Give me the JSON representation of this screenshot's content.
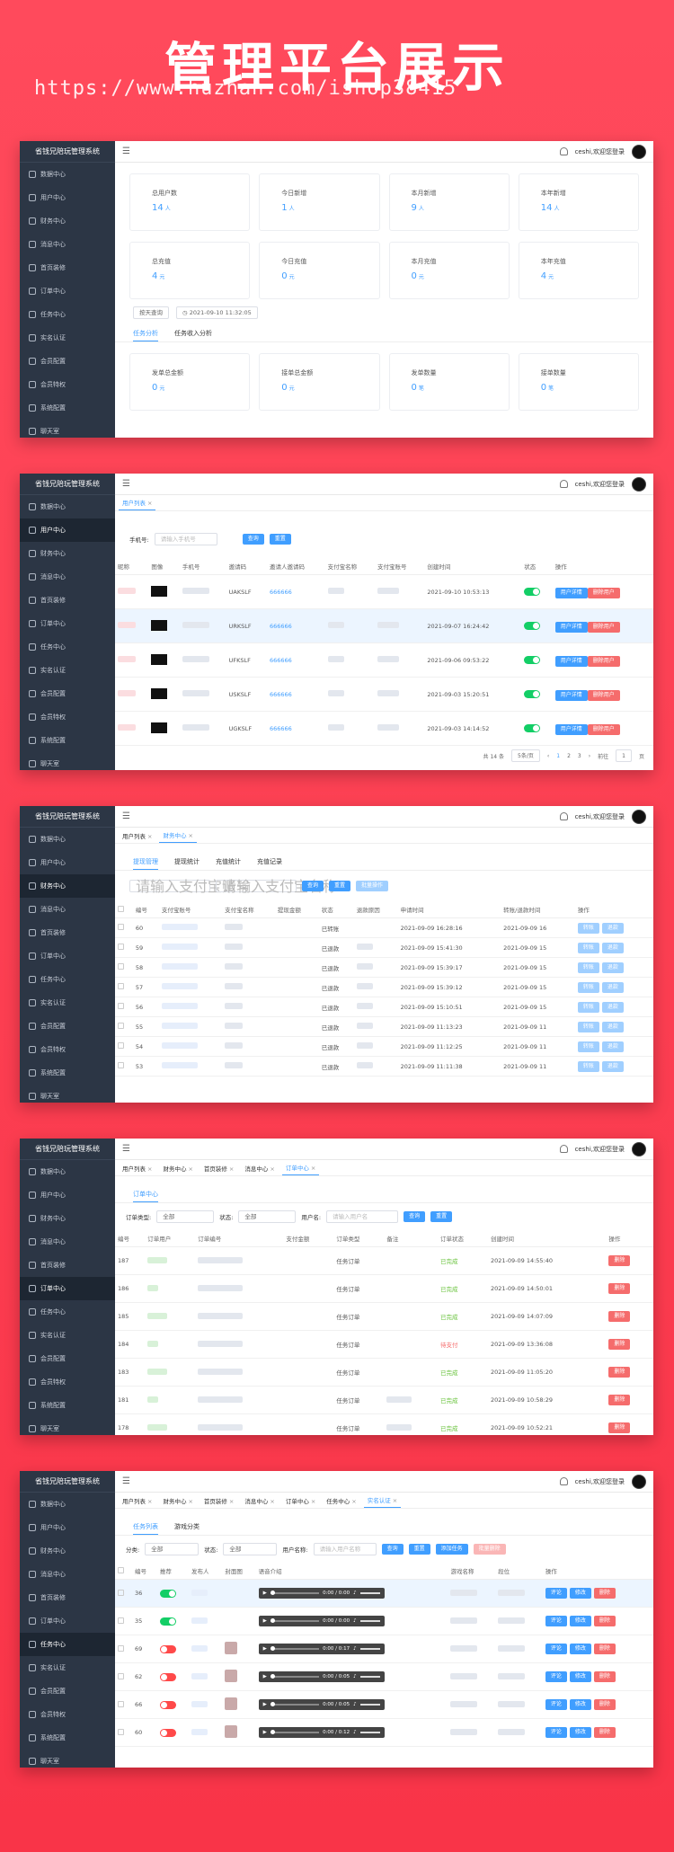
{
  "hero": {
    "title": "管理平台展示",
    "url": "https://www.huzhan.com/ishop38415"
  },
  "app": {
    "name": "省钱兄陪玩管理系统",
    "user": "ceshi",
    "greeting": ",欢迎您登录"
  },
  "sidebar": [
    "数据中心",
    "用户中心",
    "财务中心",
    "消息中心",
    "首页装修",
    "订单中心",
    "任务中心",
    "实名认证",
    "会员配置",
    "会员特权",
    "系统配置",
    "聊天室"
  ],
  "s1": {
    "cards_top": [
      {
        "label": "总用户数",
        "value": "14",
        "unit": "人"
      },
      {
        "label": "今日新增",
        "value": "1",
        "unit": "人"
      },
      {
        "label": "本月新增",
        "value": "9",
        "unit": "人"
      },
      {
        "label": "本年新增",
        "value": "14",
        "unit": "人"
      }
    ],
    "cards_mid": [
      {
        "label": "总充值",
        "value": "4",
        "unit": "元"
      },
      {
        "label": "今日充值",
        "value": "0",
        "unit": "元"
      },
      {
        "label": "本月充值",
        "value": "0",
        "unit": "元"
      },
      {
        "label": "本年充值",
        "value": "4",
        "unit": "元"
      }
    ],
    "filter_range": "按天查询",
    "filter_date": "2021-09-10 11:32:05",
    "subtabs": [
      "任务分析",
      "任务收入分析"
    ],
    "cards_bottom": [
      {
        "label": "发单总金额",
        "value": "0",
        "unit": "元"
      },
      {
        "label": "接单总金额",
        "value": "0",
        "unit": "元"
      },
      {
        "label": "发单数量",
        "value": "0",
        "unit": "笔"
      },
      {
        "label": "接单数量",
        "value": "0",
        "unit": "笔"
      }
    ]
  },
  "s2": {
    "tabs": [
      "用户列表"
    ],
    "phone_label": "手机号:",
    "phone_placeholder": "请输入手机号",
    "search": "查询",
    "reset": "重置",
    "headers": [
      "昵称",
      "图像",
      "手机号",
      "邀请码",
      "邀请人邀请码",
      "支付宝名称",
      "支付宝账号",
      "创建时间",
      "状态",
      "操作"
    ],
    "rows": [
      {
        "code": "UAKSLF",
        "inviter": "666666",
        "time": "2021-09-10 10:53:13"
      },
      {
        "code": "URKSLF",
        "inviter": "666666",
        "time": "2021-09-07 16:24:42"
      },
      {
        "code": "UFKSLF",
        "inviter": "666666",
        "time": "2021-09-06 09:53:22"
      },
      {
        "code": "USKSLF",
        "inviter": "666666",
        "time": "2021-09-03 15:20:51"
      },
      {
        "code": "UGKSLF",
        "inviter": "666666",
        "time": "2021-09-03 14:14:52"
      }
    ],
    "detail_btn": "用户详情",
    "del_btn": "删除用户",
    "total": "共 14 条",
    "page_size": "5条/页",
    "pages": [
      "1",
      "2",
      "3"
    ],
    "goto": "前往",
    "goto_page": "1",
    "page_unit": "页"
  },
  "s3": {
    "tabs": [
      "用户列表",
      "财务中心"
    ],
    "subtabs": [
      "提现管理",
      "提现统计",
      "充值统计",
      "充值记录"
    ],
    "ph_alipay": "请输入支付宝账号",
    "ph_name": "请输入支付宝名称",
    "search": "查询",
    "reset": "重置",
    "batch": "批量操作",
    "headers": [
      "编号",
      "支付宝账号",
      "支付宝名称",
      "提现金额",
      "状态",
      "退款原因",
      "申请时间",
      "转账/退款时间",
      "操作"
    ],
    "rows": [
      {
        "id": "60",
        "status": "已转账",
        "time": "2021-09-09 16:28:16",
        "time2": "2021-09-09 16"
      },
      {
        "id": "59",
        "status": "已退款",
        "time": "2021-09-09 15:41:30",
        "time2": "2021-09-09 15"
      },
      {
        "id": "58",
        "status": "已退款",
        "time": "2021-09-09 15:39:17",
        "time2": "2021-09-09 15"
      },
      {
        "id": "57",
        "status": "已退款",
        "time": "2021-09-09 15:39:12",
        "time2": "2021-09-09 15"
      },
      {
        "id": "56",
        "status": "已退款",
        "time": "2021-09-09 15:10:51",
        "time2": "2021-09-09 15"
      },
      {
        "id": "55",
        "status": "已退款",
        "time": "2021-09-09 11:13:23",
        "time2": "2021-09-09 11"
      },
      {
        "id": "54",
        "status": "已退款",
        "time": "2021-09-09 11:12:25",
        "time2": "2021-09-09 11"
      },
      {
        "id": "53",
        "status": "已退款",
        "time": "2021-09-09 11:11:38",
        "time2": "2021-09-09 11"
      }
    ],
    "btn_a": "转账",
    "btn_b": "退款"
  },
  "s4": {
    "tabs": [
      "用户列表",
      "财务中心",
      "首页装修",
      "消息中心",
      "订单中心"
    ],
    "subtabs": [
      "订单中心"
    ],
    "type_label": "订单类型:",
    "type_value": "全部",
    "status_label": "状态:",
    "status_value": "全部",
    "user_label": "用户名:",
    "user_placeholder": "请输入用户名",
    "search": "查询",
    "reset": "重置",
    "headers": [
      "编号",
      "订单用户",
      "订单编号",
      "支付金额",
      "订单类型",
      "备注",
      "订单状态",
      "创建时间",
      "操作"
    ],
    "rows": [
      {
        "id": "187",
        "type": "任务订单",
        "state": "已完成",
        "time": "2021-09-09 14:55:40"
      },
      {
        "id": "186",
        "type": "任务订单",
        "state": "已完成",
        "time": "2021-09-09 14:50:01"
      },
      {
        "id": "185",
        "type": "任务订单",
        "state": "已完成",
        "time": "2021-09-09 14:07:09"
      },
      {
        "id": "184",
        "type": "任务订单",
        "state": "待支付",
        "time": "2021-09-09 13:36:08"
      },
      {
        "id": "183",
        "type": "任务订单",
        "state": "已完成",
        "time": "2021-09-09 11:05:20"
      },
      {
        "id": "181",
        "type": "任务订单",
        "state": "已完成",
        "time": "2021-09-09 10:58:29"
      },
      {
        "id": "178",
        "type": "任务订单",
        "state": "已完成",
        "time": "2021-09-09 10:52:21"
      }
    ],
    "del_btn": "删除"
  },
  "s5": {
    "tabs": [
      "用户列表",
      "财务中心",
      "首页装修",
      "消息中心",
      "订单中心",
      "任务中心",
      "实名认证"
    ],
    "subtabs": [
      "任务列表",
      "游戏分类"
    ],
    "cat_label": "分类:",
    "cat_value": "全部",
    "status_label": "状态:",
    "status_value": "全部",
    "user_label": "用户名称:",
    "user_placeholder": "请输入用户名称",
    "search": "查询",
    "reset": "重置",
    "add": "添加任务",
    "batch": "批量删除",
    "headers": [
      "编号",
      "推荐",
      "发布人",
      "封面图",
      "语音介绍",
      "游戏名称",
      "段位",
      "操作"
    ],
    "rows": [
      {
        "id": "36",
        "on": true,
        "time": "0:00 / 0:00"
      },
      {
        "id": "35",
        "on": true,
        "time": "0:00 / 0:00"
      },
      {
        "id": "69",
        "on": false,
        "time": "0:00 / 0:17"
      },
      {
        "id": "62",
        "on": false,
        "time": "0:00 / 0:05"
      },
      {
        "id": "66",
        "on": false,
        "time": "0:00 / 0:05"
      },
      {
        "id": "60",
        "on": false,
        "time": "0:00 / 0:12"
      }
    ],
    "btn_a": "评论",
    "btn_b": "修改",
    "btn_c": "删除"
  }
}
